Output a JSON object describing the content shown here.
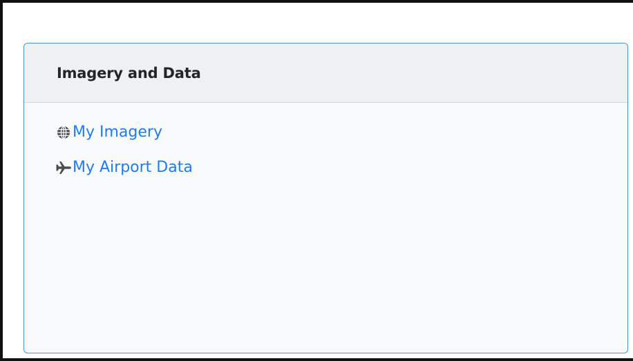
{
  "panel": {
    "title": "Imagery and Data",
    "links": [
      {
        "label": "My Imagery",
        "icon": "globe-icon"
      },
      {
        "label": "My Airport Data",
        "icon": "plane-icon"
      }
    ]
  },
  "colors": {
    "link": "#1e7bf2",
    "card_border": "#4a90d9",
    "header_bg": "#eff0f2",
    "body_bg": "#f8f9fa",
    "icon": "#4d4d4d"
  }
}
